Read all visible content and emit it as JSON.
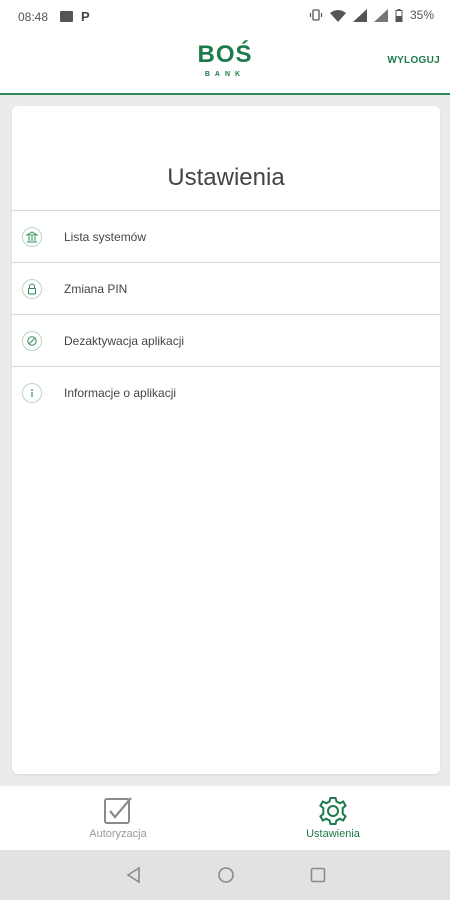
{
  "status_bar": {
    "time": "08:48",
    "p_label": "P",
    "battery": "35%",
    "icons": [
      "image-icon",
      "parking-icon",
      "vibrate-icon",
      "wifi-icon",
      "signal-icon",
      "battery-icon"
    ]
  },
  "header": {
    "logo_main": "BOŚ",
    "logo_sub": "BANK",
    "logout_label": "WYLOGUJ"
  },
  "page": {
    "title": "Ustawienia"
  },
  "menu": {
    "items": [
      {
        "label": "Lista systemów",
        "icon": "bank-icon"
      },
      {
        "label": "Zmiana PIN",
        "icon": "lock-icon"
      },
      {
        "label": "Dezaktywacja aplikacji",
        "icon": "deactivate-icon"
      },
      {
        "label": "Informacje o aplikacji",
        "icon": "info-icon"
      }
    ]
  },
  "bottom_nav": {
    "items": [
      {
        "label": "Autoryzacja",
        "icon": "checkbox-icon",
        "active": false
      },
      {
        "label": "Ustawienia",
        "icon": "gear-icon",
        "active": true
      }
    ]
  },
  "colors": {
    "brand": "#1d7a4a",
    "accent_line": "#2f8a5a",
    "background": "#ebebeb",
    "inactive": "#999999"
  }
}
